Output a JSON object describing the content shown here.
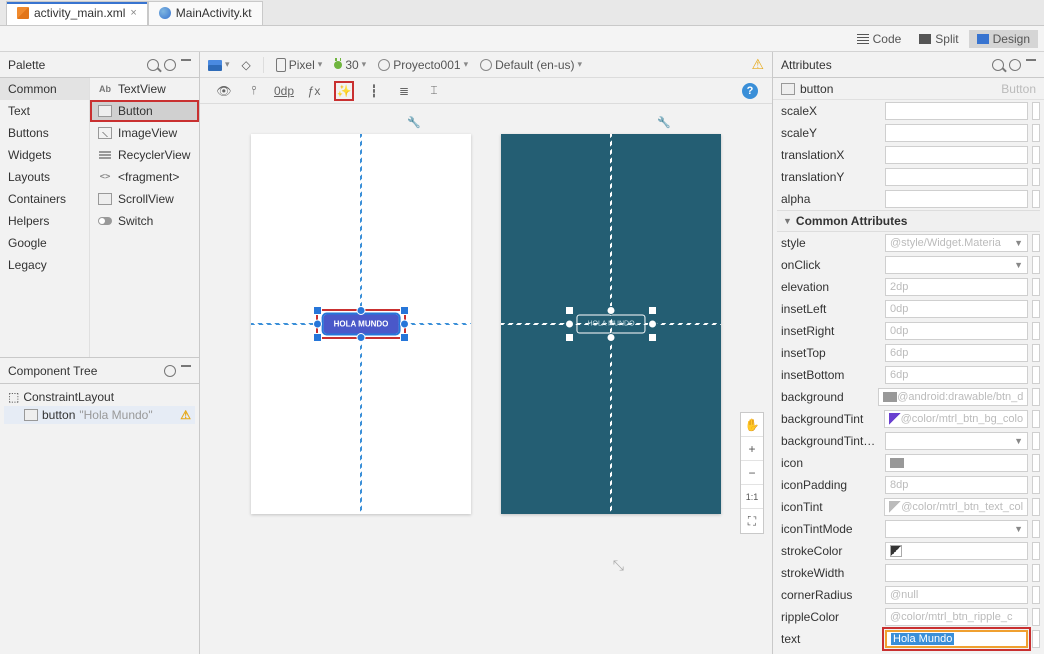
{
  "tabs": {
    "file1": "activity_main.xml",
    "file2": "MainActivity.kt"
  },
  "viewmodes": {
    "code": "Code",
    "split": "Split",
    "design": "Design"
  },
  "palette": {
    "title": "Palette",
    "cats": [
      "Common",
      "Text",
      "Buttons",
      "Widgets",
      "Layouts",
      "Containers",
      "Helpers",
      "Google",
      "Legacy"
    ],
    "items": [
      "TextView",
      "Button",
      "ImageView",
      "RecyclerView",
      "<fragment>",
      "ScrollView",
      "Switch"
    ]
  },
  "ctree": {
    "title": "Component Tree",
    "root": "ConstraintLayout",
    "child": "button",
    "childDesc": "\"Hola Mundo\""
  },
  "editor": {
    "device": "Pixel",
    "api": "30",
    "project": "Proyecto001",
    "locale": "Default (en-us)",
    "defaultMargin": "0dp",
    "buttonText": "HOLA MUNDO",
    "buttonTextBp": "HOLA MUNDO",
    "zoom": {
      "plus": "+",
      "minus": "−",
      "fit": "1:1"
    }
  },
  "attributes": {
    "title": "Attributes",
    "component": "button",
    "klass": "Button",
    "common_section": "Common Attributes",
    "rows": {
      "scaleX": "scaleX",
      "scaleY": "scaleY",
      "translationX": "translationX",
      "translationY": "translationY",
      "alpha": "alpha",
      "style": "style",
      "style_v": "@style/Widget.Materia",
      "onClick": "onClick",
      "elevation": "elevation",
      "elevation_v": "2dp",
      "insetLeft": "insetLeft",
      "insetLeft_v": "0dp",
      "insetRight": "insetRight",
      "insetRight_v": "0dp",
      "insetTop": "insetTop",
      "insetTop_v": "6dp",
      "insetBottom": "insetBottom",
      "insetBottom_v": "6dp",
      "background": "background",
      "background_v": "@android:drawable/btn_d",
      "backgroundTint": "backgroundTint",
      "backgroundTint_v": "@color/mtrl_btn_bg_colo",
      "backgroundTintM": "backgroundTintM...",
      "icon": "icon",
      "iconPadding": "iconPadding",
      "iconPadding_v": "8dp",
      "iconTint": "iconTint",
      "iconTint_v": "@color/mtrl_btn_text_col",
      "iconTintMode": "iconTintMode",
      "strokeColor": "strokeColor",
      "strokeWidth": "strokeWidth",
      "cornerRadius": "cornerRadius",
      "cornerRadius_v": "@null",
      "rippleColor": "rippleColor",
      "rippleColor_v": "@color/mtrl_btn_ripple_c",
      "text": "text",
      "text_v": "Hola Mundo"
    }
  }
}
